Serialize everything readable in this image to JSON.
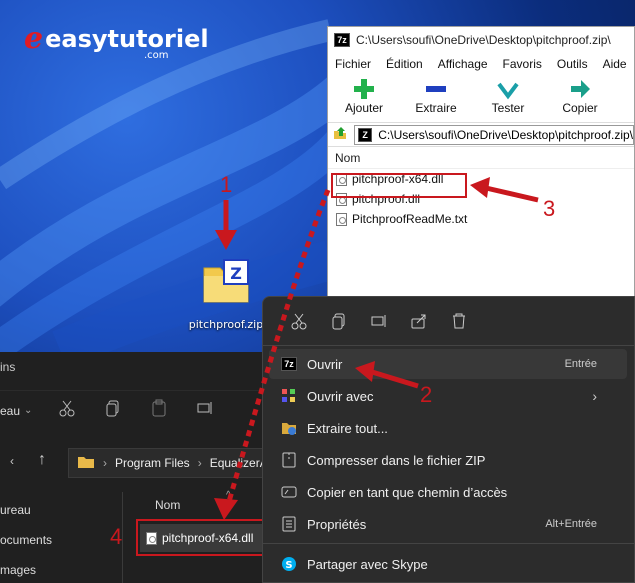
{
  "brand": {
    "name": "easytutoriel",
    "domain": ".com"
  },
  "desktop_icon": {
    "label": "pitchproof.zip"
  },
  "steps": [
    "1",
    "2",
    "3",
    "4"
  ],
  "sevenzip": {
    "title": "C:\\Users\\soufi\\OneDrive\\Desktop\\pitchproof.zip\\",
    "badge": "7z",
    "menu": [
      "Fichier",
      "Édition",
      "Affichage",
      "Favoris",
      "Outils",
      "Aide"
    ],
    "tools": [
      {
        "label": "Ajouter",
        "icon": "plus-icon",
        "color": "#22b14c"
      },
      {
        "label": "Extraire",
        "icon": "minus-icon",
        "color": "#1f3fbf"
      },
      {
        "label": "Tester",
        "icon": "check-icon",
        "color": "#1a9fa8"
      },
      {
        "label": "Copier",
        "icon": "arrow-right-icon",
        "color": "#1a9f8a"
      }
    ],
    "address": "C:\\Users\\soufi\\OneDrive\\Desktop\\pitchproof.zip\\",
    "column": "Nom",
    "files": [
      "pitchproof-x64.dll",
      "pitchproof.dll",
      "PitchproofReadMe.txt"
    ]
  },
  "explorer": {
    "title": "ins",
    "view_label": "eau",
    "path_segments": [
      "Program Files",
      "EqualizerA"
    ],
    "sidebar": [
      "ureau",
      "ocuments",
      "mages"
    ],
    "column": "Nom",
    "selected_file": "pitchproof-x64.dll"
  },
  "context_menu": {
    "items": [
      {
        "label": "Ouvrir",
        "shortcut": "Entrée",
        "icon": "sevenzip-icon"
      },
      {
        "label": "Ouvrir avec",
        "shortcut": "",
        "icon": "open-with-icon"
      },
      {
        "label": "Extraire tout...",
        "shortcut": "",
        "icon": "extract-icon"
      },
      {
        "label": "Compresser dans le fichier ZIP",
        "shortcut": "",
        "icon": "zip-icon"
      },
      {
        "label": "Copier en tant que chemin d’accès",
        "shortcut": "",
        "icon": "copy-path-icon"
      },
      {
        "label": "Propriétés",
        "shortcut": "Alt+Entrée",
        "icon": "properties-icon"
      },
      {
        "label": "Partager avec Skype",
        "shortcut": "",
        "icon": "skype-icon"
      }
    ]
  },
  "colors": {
    "annotation": "#c9181e",
    "menu_bg": "#2c2c2c",
    "explorer_bg": "#202020"
  }
}
